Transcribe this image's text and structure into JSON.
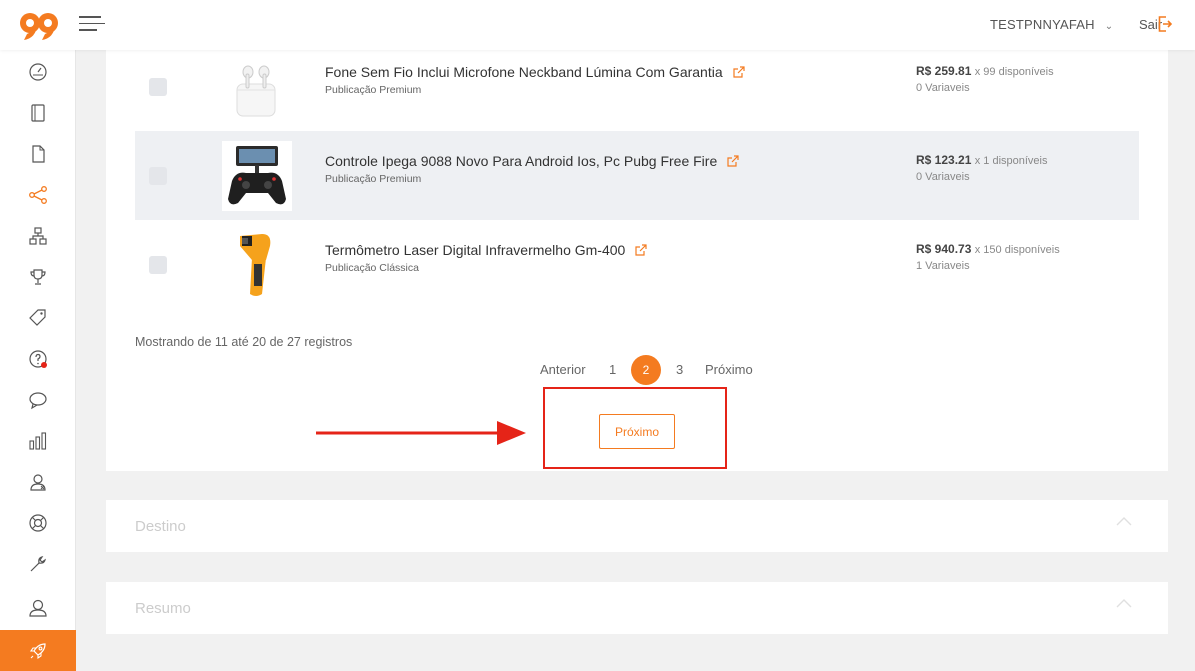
{
  "header": {
    "username": "TESTPNNYAFAH",
    "logout_label": "Sair"
  },
  "sidebar": {
    "items": [
      "speedometer-icon",
      "notebook-icon",
      "file-icon",
      "share-icon",
      "hierarchy-icon",
      "trophy-icon",
      "tag-icon",
      "help-icon",
      "chat-icon",
      "bar-chart-icon",
      "users-icon",
      "lifebuoy-icon",
      "wrench-icon",
      "user-icon",
      "rocket-icon"
    ],
    "active": "share-icon",
    "accent": "#f47b20"
  },
  "products": [
    {
      "title": "Fone Sem Fio Inclui Microfone Neckband Lúmina Com Garantia",
      "type": "Publicação Premium",
      "price": "R$ 259.81",
      "stock": "x 99 disponíveis",
      "variations": "0 Variaveis"
    },
    {
      "title": "Controle Ipega 9088 Novo Para Android Ios, Pc Pubg Free Fire",
      "type": "Publicação Premium",
      "price": "R$ 123.21",
      "stock": "x 1 disponíveis",
      "variations": "0 Variaveis"
    },
    {
      "title": "Termômetro Laser Digital Infravermelho Gm-400",
      "type": "Publicação Clássica",
      "price": "R$ 940.73",
      "stock": "x 150 disponíveis",
      "variations": "1 Variaveis"
    }
  ],
  "pagination": {
    "summary": "Mostrando de 11 até 20 de 27 registros",
    "prev": "Anterior",
    "pages": [
      "1",
      "2",
      "3"
    ],
    "current": "2",
    "next": "Próximo"
  },
  "next_button": "Próximo",
  "sections": {
    "destino": "Destino",
    "resumo": "Resumo"
  },
  "colors": {
    "accent": "#f47b20",
    "highlight": "#e52418"
  }
}
